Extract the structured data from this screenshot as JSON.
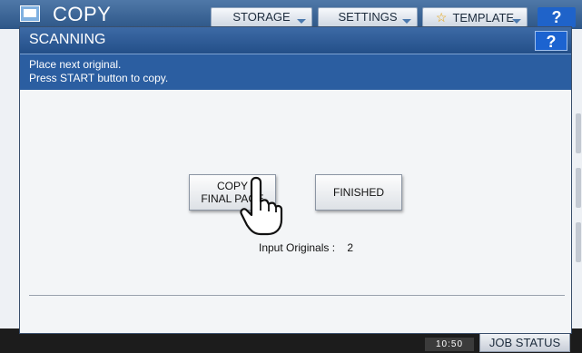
{
  "app": {
    "title": "COPY",
    "tabs": [
      {
        "label": "STORAGE",
        "icon": null
      },
      {
        "label": "SETTINGS",
        "icon": null
      },
      {
        "label": "TEMPLATE",
        "icon": "star-icon"
      }
    ],
    "help_label": "?",
    "clock": "10:50",
    "job_status_label": "JOB STATUS"
  },
  "dialog": {
    "title": "SCANNING",
    "help_label": "?",
    "message_lines": [
      "Place next original.",
      "Press START button to copy."
    ],
    "buttons": {
      "copy_final_page": "COPY FINAL PAGE",
      "finished": "FINISHED"
    },
    "originals_label": "Input Originals :",
    "originals_count": "2"
  },
  "cursor": {
    "icon": "hand-pointer-icon"
  }
}
